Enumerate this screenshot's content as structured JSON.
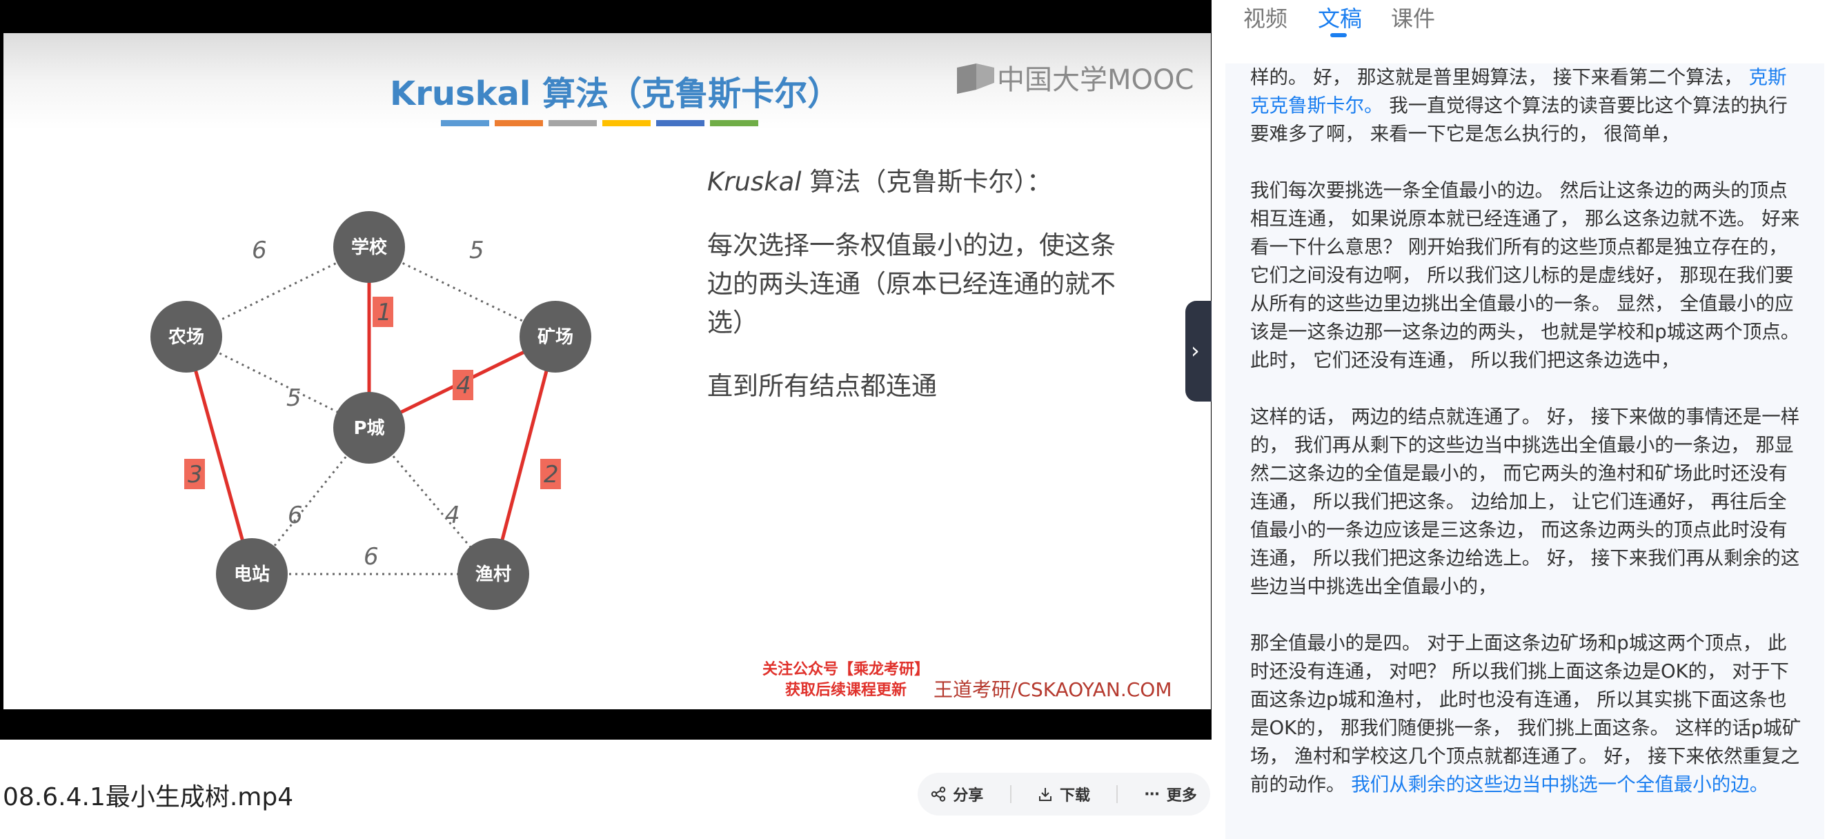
{
  "video": {
    "filename": "08.6.4.1最小生成树.mp4",
    "slide": {
      "title": "Kruskal 算法（克鲁斯卡尔）",
      "title_bar_colors": [
        "#5b9bd5",
        "#ed7d31",
        "#a5a5a5",
        "#ffc000",
        "#4472c4",
        "#70ad47"
      ],
      "logo_text": "中国大学MOOC",
      "nodes": {
        "school": "学校",
        "farm": "农场",
        "mine": "矿场",
        "pcity": "P城",
        "station": "电站",
        "fishing": "渔村"
      },
      "edges": {
        "school_farm": "6",
        "school_mine": "5",
        "school_pcity": "1",
        "farm_pcity": "5",
        "pcity_mine": "4",
        "farm_station": "3",
        "mine_fishing": "2",
        "pcity_station": "6",
        "pcity_fishing": "4",
        "station_fishing": "6"
      },
      "text_heading_italic": "Kruskal",
      "text_heading_rest": " 算法（克鲁斯卡尔）：",
      "text_body": "每次选择一条权值最小的边，使这条边的两头连通（原本已经连通的就不选）",
      "text_footer": "直到所有结点都连通",
      "promo_line1": "关注公众号【乘龙考研】",
      "promo_line2": "获取后续课程更新",
      "promo_site": "王道考研/CSKAOYAN.COM"
    },
    "collapse_icon": "chevron-right-icon"
  },
  "actions": {
    "share": "分享",
    "download": "下载",
    "more": "更多"
  },
  "tabs": {
    "video": "视频",
    "transcript": "文稿",
    "courseware": "课件",
    "active": "文稿"
  },
  "transcript": {
    "p1_a": "样的。 好， 那这就是普里姆算法， 接下来看第二个算法， ",
    "p1_hl": "克斯克克鲁斯卡尔。",
    "p1_b": " 我一直觉得这个算法的读音要比这个算法的执行要难多了啊， 来看一下它是怎么执行的， 很简单，",
    "p2": "我们每次要挑选一条全值最小的边。 然后让这条边的两头的顶点相互连通， 如果说原本就已经连通了， 那么这条边就不选。 好来看一下什么意思？ 刚开始我们所有的这些顶点都是独立存在的， 它们之间没有边啊， 所以我们这儿标的是虚线好， 那现在我们要从所有的这些边里边挑出全值最小的一条。 显然， 全值最小的应该是一这条边那一这条边的两头， 也就是学校和p城这两个顶点。 此时， 它们还没有连通， 所以我们把这条边选中，",
    "p3": "这样的话， 两边的结点就连通了。 好， 接下来做的事情还是一样的， 我们再从剩下的这些边当中挑选出全值最小的一条边， 那显然二这条边的全值是最小的， 而它两头的渔村和矿场此时还没有连通， 所以我们把这条。 边给加上， 让它们连通好， 再往后全值最小的一条边应该是三这条边， 而这条边两头的顶点此时没有连通， 所以我们把这条边给选上。 好， 接下来我们再从剩余的这些边当中挑选出全值最小的，",
    "p4_a": "那全值最小的是四。 对于上面这条边矿场和p城这两个顶点， 此时还没有连通， 对吧？ 所以我们挑上面这条边是OK的， 对于下面这条边p城和渔村， 此时也没有连通， 所以其实挑下面这条也是OK的， 那我们随便挑一条， 我们挑上面这条。 这样的话p城矿场， 渔村和学校这几个顶点就都连通了。 好， 接下来依然重复之前的动作。 ",
    "p4_hl": "我们从剩余的这些边当中挑选一个全值最小的边。"
  },
  "colors": {
    "accent": "#1a7ef0",
    "node_fill": "#606060",
    "selected_edge": "#e0312b",
    "weight_box": "#f06a5a",
    "slide_title": "#3f86c6"
  }
}
